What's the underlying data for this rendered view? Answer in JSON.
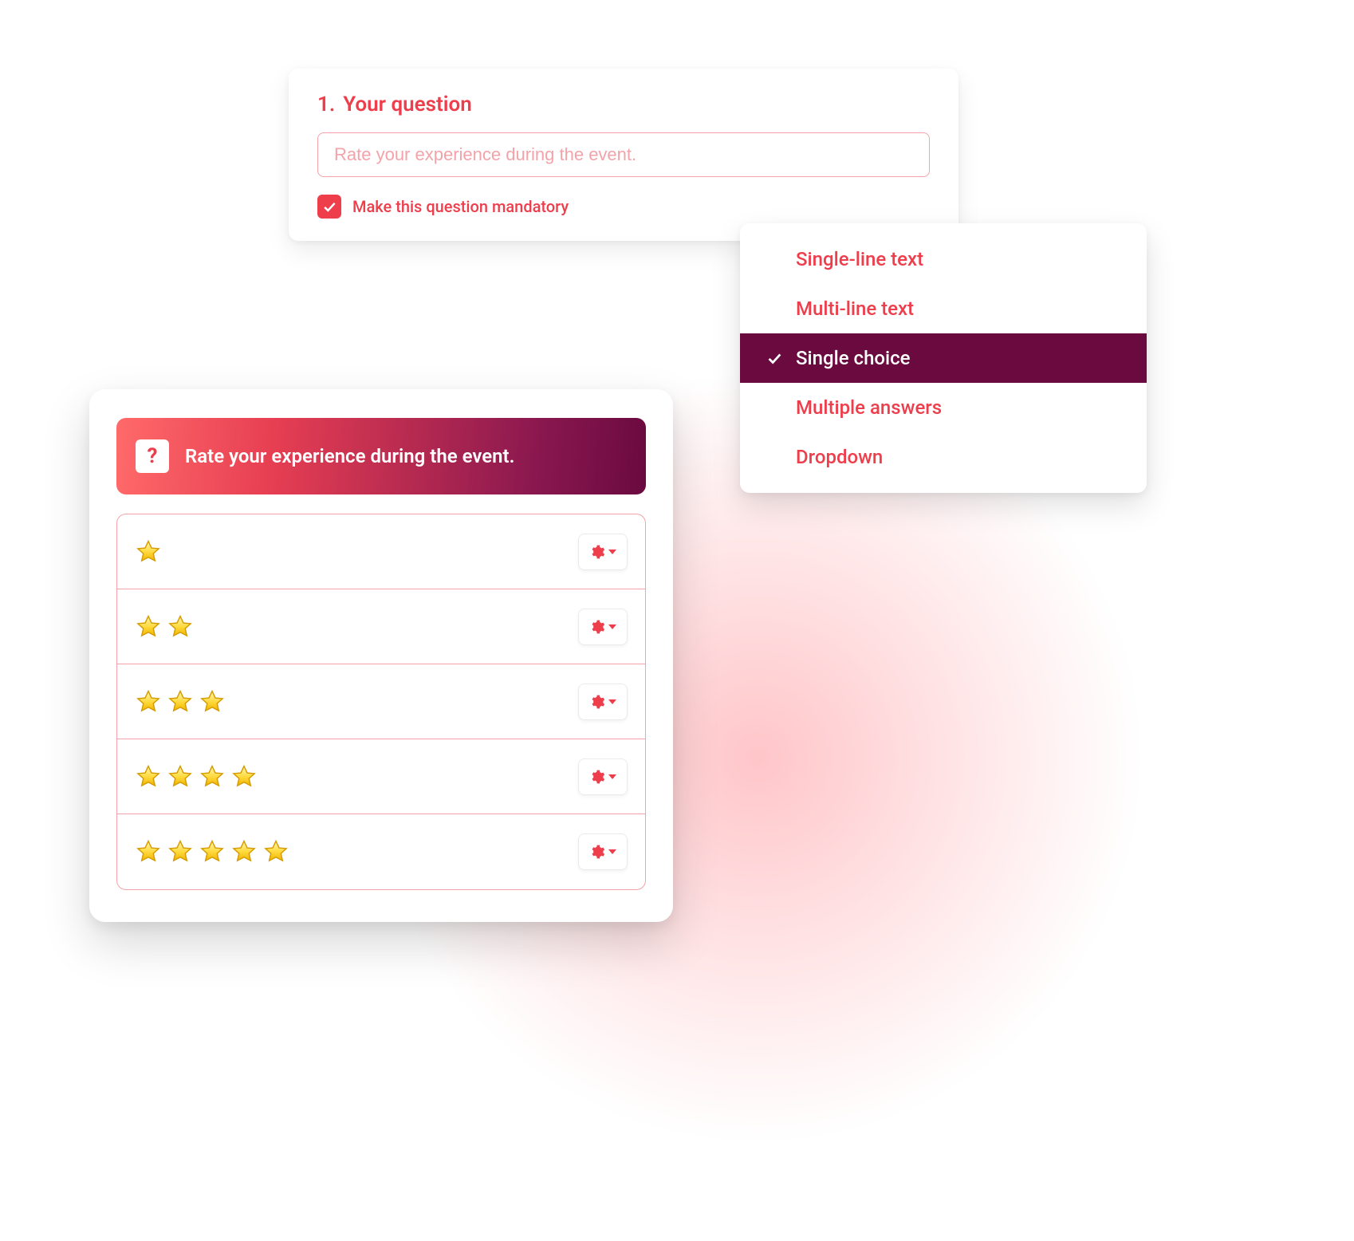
{
  "editor": {
    "number": "1.",
    "title": "Your question",
    "input_value": "Rate your experience during the event.",
    "mandatory_checked": true,
    "mandatory_label": "Make this question mandatory"
  },
  "type_menu": {
    "items": [
      {
        "label": "Single-line text",
        "selected": false
      },
      {
        "label": "Multi-line text",
        "selected": false
      },
      {
        "label": "Single choice",
        "selected": true
      },
      {
        "label": "Multiple answers",
        "selected": false
      },
      {
        "label": "Dropdown",
        "selected": false
      }
    ]
  },
  "preview": {
    "icon_glyph": "?",
    "title": "Rate your experience during the event.",
    "options": [
      {
        "stars": 1
      },
      {
        "stars": 2
      },
      {
        "stars": 3
      },
      {
        "stars": 4
      },
      {
        "stars": 5
      }
    ]
  },
  "colors": {
    "accent": "#ee3e4c",
    "accent_dark": "#6a0a3f",
    "border_soft": "#f3a3a9"
  }
}
